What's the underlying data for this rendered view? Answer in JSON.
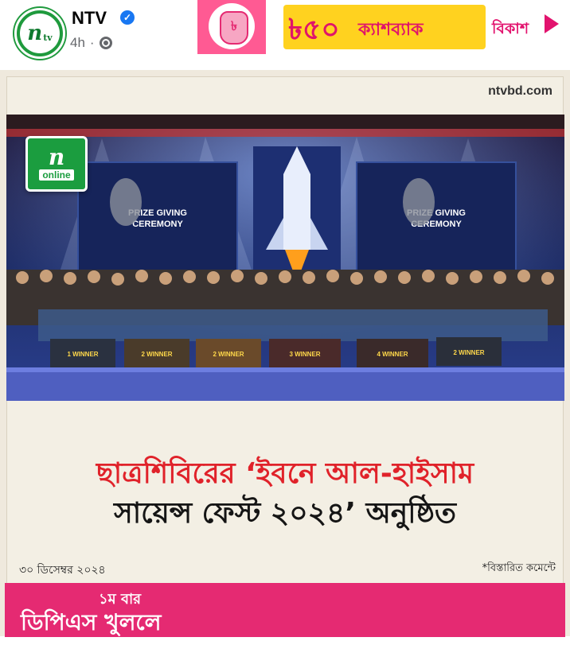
{
  "header": {
    "page_name": "NTV",
    "verified_icon": "verified-badge-icon",
    "timestamp": "4h",
    "audience_icon": "globe-icon",
    "more_label": "•••",
    "close_label": "✕"
  },
  "post": {
    "source_url": "ntvbd.com",
    "logo_text": "n",
    "logo_sub": "online",
    "photo": {
      "stage_left_sign": "PRIZE GIVING CEREMONY",
      "stage_right_sign": "PRIZE GIVING CEREMONY",
      "winner_banners": [
        "1 WINNER",
        "2 WINNER",
        "2 WINNER",
        "3 WINNER",
        "4 WINNER",
        "2 WINNER"
      ]
    },
    "headline_line1": "ছাত্রশিবিরের ‘ইবনে আল-হাইসাম",
    "headline_line2": "সায়েন্স ফেস্ট ২০২৪’ অনুষ্ঠিত",
    "date": "৩০ ডিসেম্বর ২০২৪",
    "details_note": "*বিস্তারিত কমেন্টে"
  },
  "ad": {
    "line1": "১ম বার",
    "line2": "ডিপিএস খুললে",
    "pot_symbol": "৳",
    "amount": "৳৫০",
    "cashback_word": "ক্যাশব্যাক",
    "brand": "বিকাশ",
    "colors": {
      "pink": "#e52a72",
      "yellow": "#ffd21f"
    }
  },
  "colors": {
    "ntv_green": "#1b9d3f",
    "headline_red": "#e0222a",
    "headline_dark": "#151515"
  }
}
